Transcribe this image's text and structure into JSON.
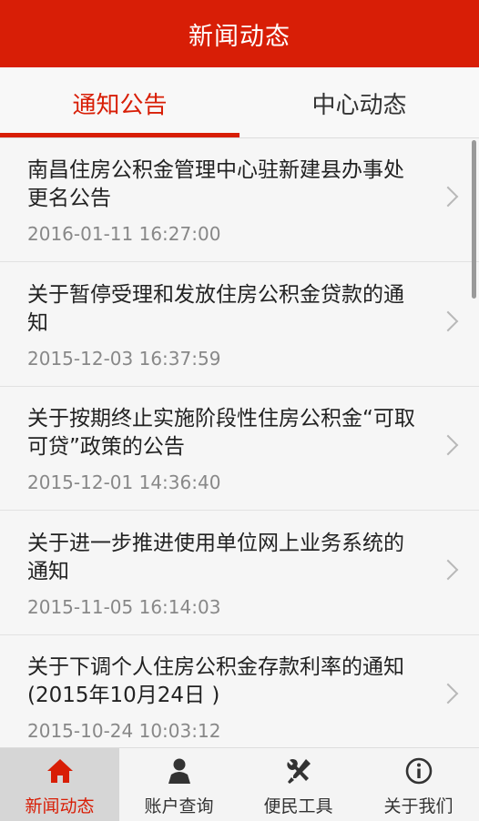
{
  "header": {
    "title": "新闻动态"
  },
  "tabs": [
    {
      "label": "通知公告",
      "active": true
    },
    {
      "label": "中心动态",
      "active": false
    }
  ],
  "news": [
    {
      "title": "南昌住房公积金管理中心驻新建县办事处更名公告",
      "time": "2016-01-11 16:27:00"
    },
    {
      "title": "关于暂停受理和发放住房公积金贷款的通知",
      "time": "2015-12-03 16:37:59"
    },
    {
      "title": "关于按期终止实施阶段性住房公积金“可取可贷”政策的公告",
      "time": "2015-12-01 14:36:40"
    },
    {
      "title": "关于进一步推进使用单位网上业务系统的通知",
      "time": "2015-11-05 16:14:03"
    },
    {
      "title": "关于下调个人住房公积金存款利率的通知(2015年10月24日 )",
      "time": "2015-10-24 10:03:12"
    }
  ],
  "bottom_nav": [
    {
      "label": "新闻动态",
      "icon": "home-icon",
      "active": true
    },
    {
      "label": "账户查询",
      "icon": "user-icon",
      "active": false
    },
    {
      "label": "便民工具",
      "icon": "tools-icon",
      "active": false
    },
    {
      "label": "关于我们",
      "icon": "info-icon",
      "active": false
    }
  ],
  "colors": {
    "brand": "#d81e06",
    "active_nav_bg": "#d6d6d6"
  }
}
